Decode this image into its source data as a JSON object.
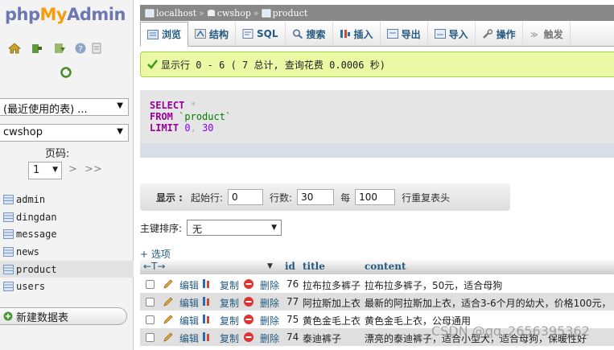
{
  "left": {
    "logo": {
      "php": "php",
      "my": "My",
      "admin": "Admin"
    },
    "recent_tables": "(最近使用的表) ...",
    "database": "cwshop",
    "pager_label": "页码:",
    "pager_value": "1",
    "pager_next": ">",
    "pager_last": ">>",
    "tables": [
      "admin",
      "dingdan",
      "message",
      "news",
      "product",
      "users"
    ],
    "active_table": "product",
    "new_table": "新建数据表"
  },
  "breadcrumb": {
    "server": "localhost",
    "sep1": "»",
    "database": "cwshop",
    "sep2": "»",
    "table": "product"
  },
  "tabs": [
    {
      "label": "浏览",
      "icon": "browse-icon"
    },
    {
      "label": "结构",
      "icon": "structure-icon"
    },
    {
      "label": "SQL",
      "icon": "sql-icon"
    },
    {
      "label": "搜索",
      "icon": "search-icon"
    },
    {
      "label": "插入",
      "icon": "insert-icon"
    },
    {
      "label": "导出",
      "icon": "export-icon"
    },
    {
      "label": "导入",
      "icon": "import-icon"
    },
    {
      "label": "操作",
      "icon": "wrench-icon"
    },
    {
      "label": "触发",
      "icon": "trigger-icon"
    }
  ],
  "success_message": "显示行 0 - 6 ( 7 总计, 查询花费 0.0006 秒)",
  "sql": {
    "select": "SELECT",
    "star": "*",
    "from": "FROM",
    "table": "`product`",
    "limit": "LIMIT",
    "offset": "0",
    "comma": ",",
    "count": "30"
  },
  "nav": {
    "show_label": "显示 :",
    "start_label": "起始行:",
    "start_value": "0",
    "rows_label": "行数:",
    "rows_value": "30",
    "every_label": "每",
    "every_value": "100",
    "repeat_label": "行重复表头"
  },
  "sort": {
    "label": "主键排序:",
    "value": "无"
  },
  "options_link": "+ 选项",
  "table_header": {
    "arrows": "←T→",
    "id": "id",
    "title": "title",
    "content": "content"
  },
  "actions": {
    "edit": "编辑",
    "copy": "复制",
    "delete": "删除"
  },
  "rows": [
    {
      "id": "76",
      "title": "拉布拉多裤子",
      "content": "拉布拉多裤子，50元，适合母狗"
    },
    {
      "id": "77",
      "title": "阿拉斯加上衣",
      "content": "最新的阿拉斯加上衣，适合3-6个月的幼犬，价格100元，"
    },
    {
      "id": "75",
      "title": "黄色金毛上衣",
      "content": "黄色金毛上衣，公母通用"
    },
    {
      "id": "74",
      "title": "泰迪裤子",
      "content": "漂亮的泰迪裤子，适合小型犬，适合母狗，保暖性好"
    }
  ],
  "watermark": "CSDN @qq_2656395362",
  "colors": {
    "link": "#235a81",
    "success_bg": "#ebf8a4",
    "sql_keyword": "#990099",
    "logo_blue": "#6c78af",
    "logo_orange": "#f89c0e"
  }
}
